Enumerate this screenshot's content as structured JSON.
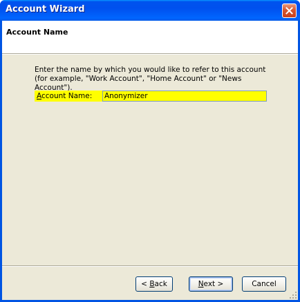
{
  "window": {
    "title": "Account Wizard"
  },
  "header": {
    "title": "Account Name"
  },
  "body": {
    "description": "Enter the name by which you would like to refer to this account (for example, \"Work Account\", \"Home Account\" or \"News Account\")."
  },
  "field": {
    "label_accel": "A",
    "label_rest": "ccount Name:",
    "value": "Anonymizer"
  },
  "buttons": {
    "back_prefix": "< ",
    "back_accel": "B",
    "back_rest": "ack",
    "next_prefix": "",
    "next_accel": "N",
    "next_rest": "ext >",
    "cancel": "Cancel"
  },
  "colors": {
    "titlebar": "#0054e3",
    "dialog_bg": "#ece9d8",
    "highlight": "#ffff00",
    "close_button": "#d7562e"
  },
  "icons": {
    "close": "close-icon",
    "grip": "resize-grip-icon"
  }
}
